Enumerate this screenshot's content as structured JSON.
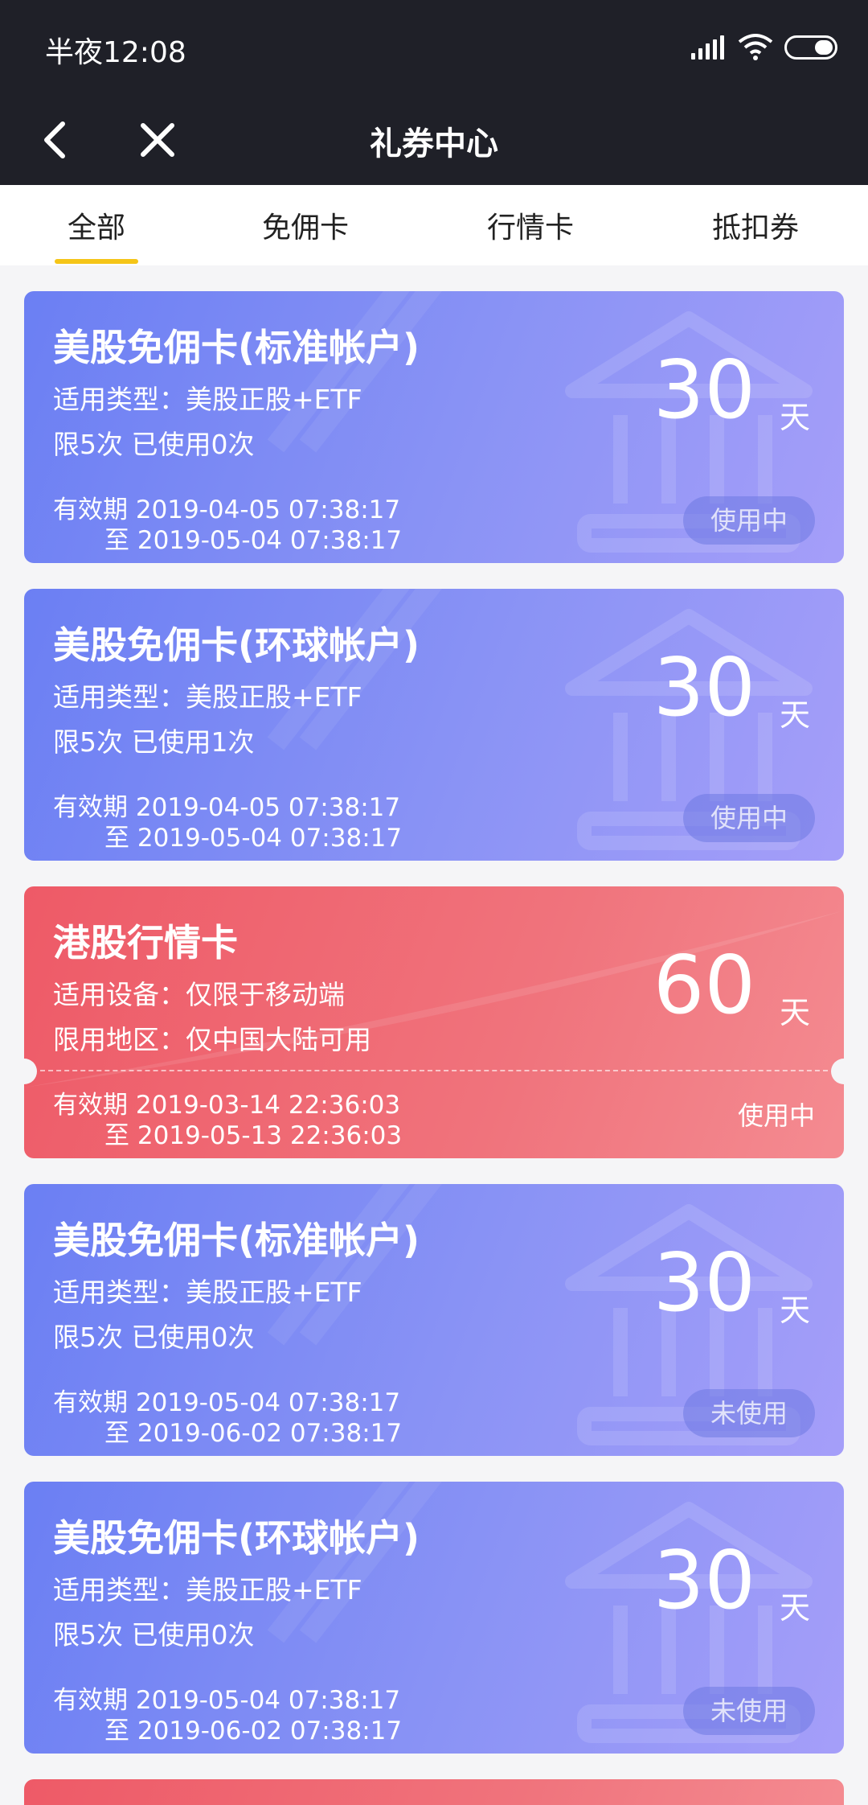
{
  "status_bar": {
    "time": "半夜12:08"
  },
  "nav": {
    "title": "礼券中心"
  },
  "tabs": [
    {
      "label": "全部",
      "active": true
    },
    {
      "label": "免佣卡"
    },
    {
      "label": "行情卡"
    },
    {
      "label": "抵扣券"
    }
  ],
  "colors": {
    "blue_card": "#7a86f4",
    "red_card": "#ee5e6a",
    "tab_indicator": "#f5c518",
    "header": "#1f2028"
  },
  "cards": [
    {
      "style": "blue",
      "title": "美股免佣卡(标准帐户)",
      "line1": "适用类型：美股正股+ETF",
      "line2": "限5次 已使用0次",
      "from": "有效期 2019-04-05 07:38:17",
      "to": "至 2019-05-04 07:38:17",
      "days": "30",
      "unit": "天",
      "status": "使用中"
    },
    {
      "style": "blue",
      "title": "美股免佣卡(环球帐户)",
      "line1": "适用类型：美股正股+ETF",
      "line2": "限5次 已使用1次",
      "from": "有效期 2019-04-05 07:38:17",
      "to": "至 2019-05-04 07:38:17",
      "days": "30",
      "unit": "天",
      "status": "使用中"
    },
    {
      "style": "red",
      "title": "港股行情卡",
      "line1": "适用设备：仅限于移动端",
      "line2": "限用地区：仅中国大陆可用",
      "from": "有效期 2019-03-14 22:36:03",
      "to": "至 2019-05-13 22:36:03",
      "days": "60",
      "unit": "天",
      "status": "使用中"
    },
    {
      "style": "blue",
      "title": "美股免佣卡(标准帐户)",
      "line1": "适用类型：美股正股+ETF",
      "line2": "限5次 已使用0次",
      "from": "有效期 2019-05-04 07:38:17",
      "to": "至 2019-06-02 07:38:17",
      "days": "30",
      "unit": "天",
      "status": "未使用"
    },
    {
      "style": "blue",
      "title": "美股免佣卡(环球帐户)",
      "line1": "适用类型：美股正股+ETF",
      "line2": "限5次 已使用0次",
      "from": "有效期 2019-05-04 07:38:17",
      "to": "至 2019-06-02 07:38:17",
      "days": "30",
      "unit": "天",
      "status": "未使用"
    }
  ]
}
